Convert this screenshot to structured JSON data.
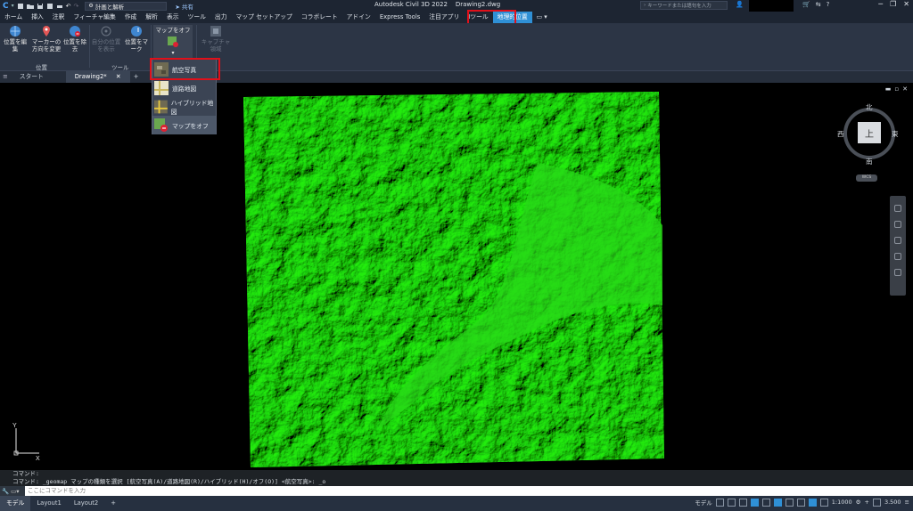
{
  "titlebar": {
    "workspace": "計画と解析",
    "share": "共有",
    "app_title": "Autodesk Civil 3D 2022",
    "drawing_name": "Drawing2.dwg",
    "search_placeholder": "キーワードまたは語句を入力"
  },
  "menu_tabs": [
    {
      "label": "ホーム"
    },
    {
      "label": "挿入"
    },
    {
      "label": "注釈"
    },
    {
      "label": "フィーチャ編集"
    },
    {
      "label": "作成"
    },
    {
      "label": "解析"
    },
    {
      "label": "表示"
    },
    {
      "label": "ツール"
    },
    {
      "label": "出力"
    },
    {
      "label": "マップ セットアップ"
    },
    {
      "label": "コラボレート"
    },
    {
      "label": "アドイン"
    },
    {
      "label": "Express Tools"
    },
    {
      "label": "注目アプリ"
    },
    {
      "label": "Iツール"
    },
    {
      "label": "地理的位置"
    }
  ],
  "ribbon": {
    "buttons": {
      "edit_location": "位置を編集",
      "marker_change": "マーカーの方向を変更",
      "remove_location": "位置を除去",
      "my_location": "自分の位置を表示",
      "mark_position": "位置をマーク",
      "map_off": "マップをオフ",
      "capture": "キャプチャ領域"
    },
    "groups": {
      "position": "位置",
      "tools": "ツール"
    }
  },
  "dropdown": {
    "items": [
      "航空写真",
      "道路地図",
      "ハイブリッド地図",
      "マップをオフ"
    ]
  },
  "doc_tabs": {
    "start": "スタート",
    "drawing": "Drawing2*",
    "add": "+"
  },
  "viewcube": {
    "north": "北",
    "south": "南",
    "east": "東",
    "west": "西",
    "top": "上",
    "wcs": "WCS"
  },
  "ucs": {
    "x": "X",
    "y": "Y"
  },
  "command": {
    "line1": "コマンド:",
    "line2": "コマンド: _geomap マップの種類を選択 [航空写真(A)/道路地図(R)/ハイブリッド(H)/オフ(O)] <航空写真>: _o",
    "placeholder": "ここにコマンドを入力"
  },
  "status": {
    "tabs": [
      "モデル",
      "Layout1",
      "Layout2"
    ],
    "mode": "モデル",
    "scale": "1:1000",
    "value": "3.500"
  },
  "colors": {
    "accent": "#2f90d6",
    "highlight": "#e0101a",
    "terrain": "#22dd11"
  }
}
